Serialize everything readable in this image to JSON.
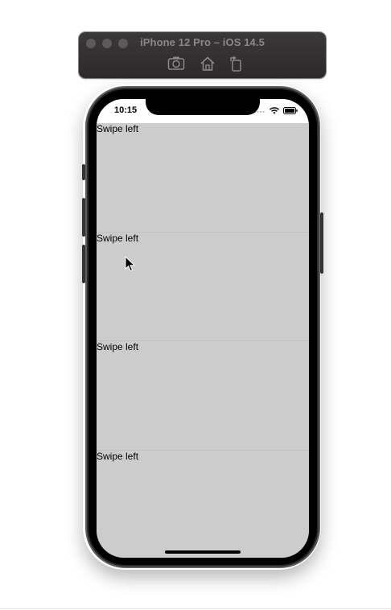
{
  "simulator": {
    "title": "iPhone 12 Pro – iOS 14.5",
    "toolbar_buttons": [
      {
        "name": "screenshot",
        "icon": "camera-icon"
      },
      {
        "name": "home",
        "icon": "home-icon"
      },
      {
        "name": "rotate",
        "icon": "rotate-icon"
      }
    ]
  },
  "status_bar": {
    "time": "10:15"
  },
  "list": {
    "rows": [
      {
        "label": "Swipe left"
      },
      {
        "label": "Swipe left"
      },
      {
        "label": "Swipe left"
      },
      {
        "label": "Swipe left"
      }
    ]
  },
  "colors": {
    "row_background": "#cccccc",
    "toolbar_background": "#323031"
  }
}
